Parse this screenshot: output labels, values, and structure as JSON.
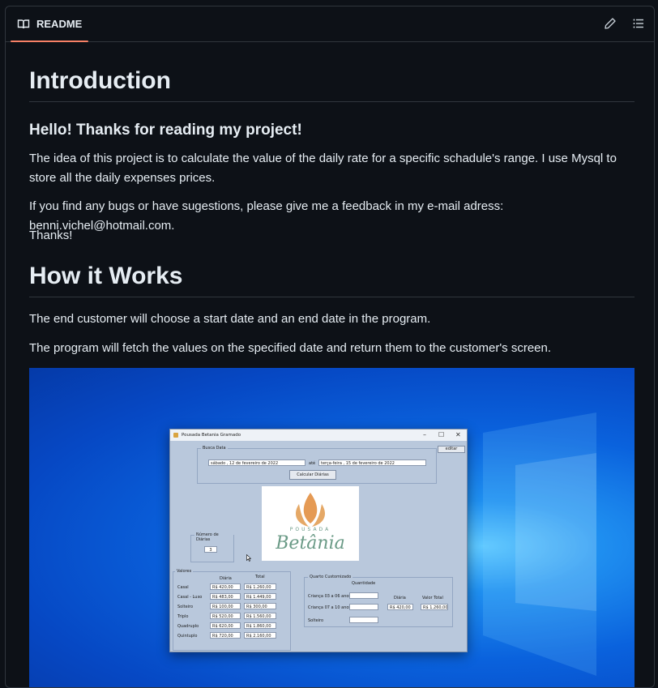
{
  "header": {
    "tab_label": "README"
  },
  "readme": {
    "h1_intro": "Introduction",
    "h2_hello": "Hello! Thanks for reading my project!",
    "p1": "The idea of this project is to calculate the value of the daily rate for a specific schadule's range. I use Mysql to store all the daily expenses prices.",
    "p2": "If you find any bugs or have sugestions, please give me a feedback in my e-mail adress: benni.vichel@hotmail.com.",
    "p3": "Thanks!",
    "h1_how": "How it Works",
    "p4": "The end customer will choose a start date and an end date in the program.",
    "p5": "The program will fetch the values on the specified date and return them to the customer's screen."
  },
  "app": {
    "title": "Pousada Betania Gramado",
    "busca_title": "Busca Data",
    "start_date": "sábado   , 12 de fevereiro de 2022",
    "ate": "até",
    "end_date": "terça-feira , 15 de fevereiro de 2022",
    "calc_button": "Calcular Diárias",
    "editar_button": "editar",
    "logo_top": "POUSADA",
    "logo_name": "Betânia",
    "num_diarias_title": "Número de Diárias",
    "num_diarias_value": "3",
    "valores_title": "Valores",
    "col_diaria": "Diária",
    "col_total": "Total",
    "rooms": [
      {
        "name": "Casal",
        "diaria": "R$ 420,00",
        "total": "R$ 1.260,00"
      },
      {
        "name": "Casal - Luxo",
        "diaria": "R$ 483,00",
        "total": "R$ 1.449,00"
      },
      {
        "name": "Solteiro",
        "diaria": "R$ 100,00",
        "total": "R$ 300,00"
      },
      {
        "name": "Triplo",
        "diaria": "R$ 520,00",
        "total": "R$ 1.560,00"
      },
      {
        "name": "Quadruplo",
        "diaria": "R$ 620,00",
        "total": "R$ 1.860,00"
      },
      {
        "name": "Quintuplo",
        "diaria": "R$ 720,00",
        "total": "R$ 2.160,00"
      }
    ],
    "custom_title": "Quarto Customizado",
    "quantidade": "Quantidade",
    "crianca_0_6": "Criança 03 a 06 anos",
    "crianca_7_10": "Criança 07 a 10 anos",
    "solteiro": "Solteiro",
    "diaria_label": "Diária",
    "valor_total_label": "Valor Total",
    "custom_diaria": "R$ 420,00",
    "custom_total": "R$ 1.260,00"
  }
}
